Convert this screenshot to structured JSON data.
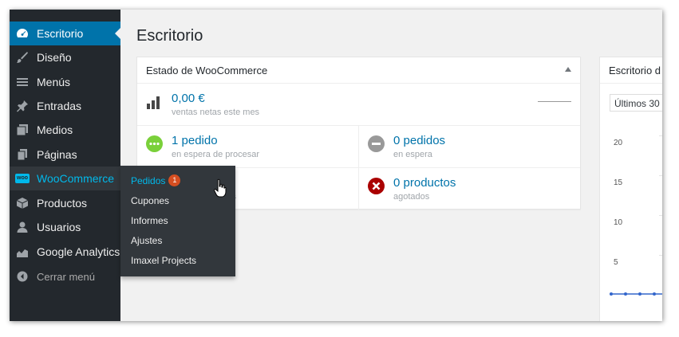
{
  "sidebar": {
    "items": [
      {
        "label": "Escritorio",
        "icon": "dashboard-icon"
      },
      {
        "label": "Diseño",
        "icon": "brush-icon"
      },
      {
        "label": "Menús",
        "icon": "menu-icon"
      },
      {
        "label": "Entradas",
        "icon": "pin-icon"
      },
      {
        "label": "Medios",
        "icon": "media-icon"
      },
      {
        "label": "Páginas",
        "icon": "pages-icon"
      },
      {
        "label": "WooCommerce",
        "icon": "woocommerce-icon",
        "icon_text": "woo"
      },
      {
        "label": "Productos",
        "icon": "box-icon"
      },
      {
        "label": "Usuarios",
        "icon": "user-icon"
      },
      {
        "label": "Google Analytics",
        "icon": "analytics-icon"
      }
    ],
    "collapse_label": "Cerrar menú"
  },
  "flyout": {
    "items": [
      {
        "label": "Pedidos",
        "badge": "1"
      },
      {
        "label": "Cupones"
      },
      {
        "label": "Informes"
      },
      {
        "label": "Ajustes"
      },
      {
        "label": "Imaxel Projects"
      }
    ]
  },
  "page": {
    "title": "Escritorio"
  },
  "woo_status": {
    "title": "Estado de WooCommerce",
    "sales": {
      "value": "0,00 €",
      "caption": "ventas netas este mes"
    },
    "processing": {
      "value": "1 pedido",
      "caption": "en espera de procesar"
    },
    "on_hold": {
      "value": "0 pedidos",
      "caption": "en espera"
    },
    "low_stock": {
      "value": "s",
      "caption": "ias"
    },
    "out_of_stock": {
      "value": "0 productos",
      "caption": "agotados"
    }
  },
  "right_panel": {
    "title": "Escritorio d",
    "range_select": "Últimos 30",
    "y_ticks": [
      "20",
      "15",
      "10",
      "5"
    ]
  },
  "colors": {
    "sidebar_bg": "#23282d",
    "accent_blue": "#0073aa",
    "woo_blue": "#00b9eb",
    "green": "#7ad03a",
    "grey": "#999999",
    "red": "#d54e21"
  }
}
